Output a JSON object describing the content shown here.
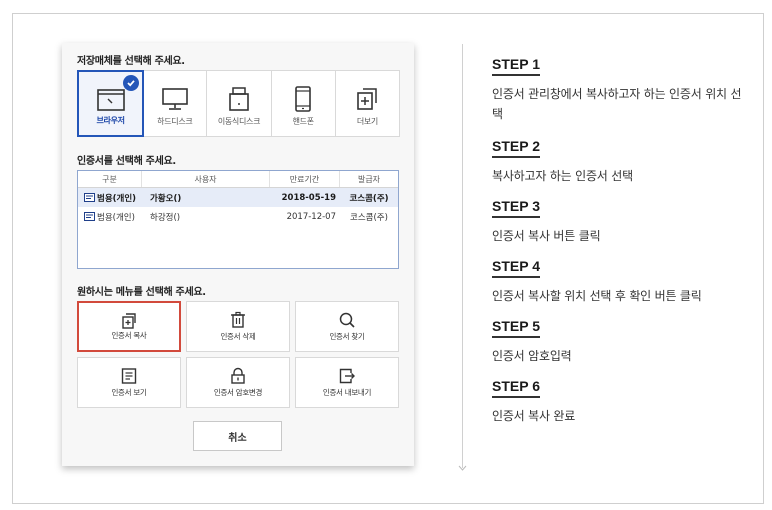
{
  "dialog": {
    "media_title": "저장매체를 선택해 주세요.",
    "media": [
      {
        "label": "브라우저",
        "icon": "browser-icon",
        "selected": true
      },
      {
        "label": "하드디스크",
        "icon": "monitor-icon",
        "selected": false
      },
      {
        "label": "이동식디스크",
        "icon": "usb-drive-icon",
        "selected": false
      },
      {
        "label": "핸드폰",
        "icon": "phone-icon",
        "selected": false
      },
      {
        "label": "더보기",
        "icon": "more-plus-icon",
        "selected": false
      }
    ],
    "cert_title": "인증서를 선택해 주세요.",
    "cert_columns": [
      "구분",
      "사용자",
      "만료기간",
      "발급자"
    ],
    "cert_rows": [
      {
        "type": "범용(개인)",
        "user": "가황오()",
        "expiry": "2018-05-19",
        "issuer": "코스콤(주)",
        "selected": true
      },
      {
        "type": "범용(개인)",
        "user": "하강정()",
        "expiry": "2017-12-07",
        "issuer": "코스콤(주)",
        "selected": false
      }
    ],
    "menu_title": "원하시는 메뉴를 선택해 주세요.",
    "menu": [
      {
        "label": "인증서 복사",
        "icon": "copy-icon",
        "highlighted": true
      },
      {
        "label": "인증서 삭제",
        "icon": "trash-icon",
        "highlighted": false
      },
      {
        "label": "인증서 찾기",
        "icon": "search-icon",
        "highlighted": false
      },
      {
        "label": "인증서 보기",
        "icon": "document-icon",
        "highlighted": false
      },
      {
        "label": "인증서 암호변경",
        "icon": "lock-icon",
        "highlighted": false
      },
      {
        "label": "인증서 내보내기",
        "icon": "export-icon",
        "highlighted": false
      }
    ],
    "cancel_label": "취소"
  },
  "steps": [
    {
      "title": "STEP 1",
      "desc": "인증서 관리창에서 복사하고자 하는 인증서 위치 선택"
    },
    {
      "title": "STEP 2",
      "desc": "복사하고자 하는 인증서 선택"
    },
    {
      "title": "STEP 3",
      "desc": "인증서 복사 버튼 클릭"
    },
    {
      "title": "STEP 4",
      "desc": "인증서 복사할 위치 선택 후 확인 버튼 클릭"
    },
    {
      "title": "STEP 5",
      "desc": "인증서 암호입력"
    },
    {
      "title": "STEP 6",
      "desc": "인증서 복사 완료"
    }
  ],
  "colors": {
    "accent": "#2456b8",
    "highlight": "#d24a3c"
  }
}
